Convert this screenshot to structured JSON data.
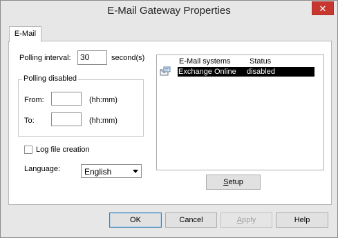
{
  "window": {
    "title": "E-Mail Gateway Properties",
    "close_glyph": "✕"
  },
  "tabs": [
    {
      "label": "E-Mail",
      "selected": true
    }
  ],
  "polling": {
    "interval_label": "Polling interval:",
    "interval_value": "30",
    "interval_unit": "second(s)",
    "disabled_group_title": "Polling disabled",
    "from_label": "From:",
    "from_value": "",
    "from_hint": "(hh:mm)",
    "to_label": "To:",
    "to_value": "",
    "to_hint": "(hh:mm)"
  },
  "log_file": {
    "label": "Log file creation",
    "checked": false
  },
  "language": {
    "label": "Language:",
    "selected": "English"
  },
  "email_systems": {
    "columns": [
      "E-Mail systems",
      "Status"
    ],
    "rows": [
      {
        "icon": "mail-system-icon",
        "name": "Exchange Online",
        "status": "disabled",
        "selected": true
      }
    ],
    "setup_button": {
      "label_underlined": "S",
      "label_rest": "etup"
    }
  },
  "footer_buttons": {
    "ok": "OK",
    "cancel": "Cancel",
    "apply_underlined": "A",
    "apply_rest": "pply",
    "help": "Help"
  },
  "colors": {
    "close_bg": "#c7372f",
    "selection_bg": "#000000",
    "window_bg": "#e7e7e7"
  }
}
